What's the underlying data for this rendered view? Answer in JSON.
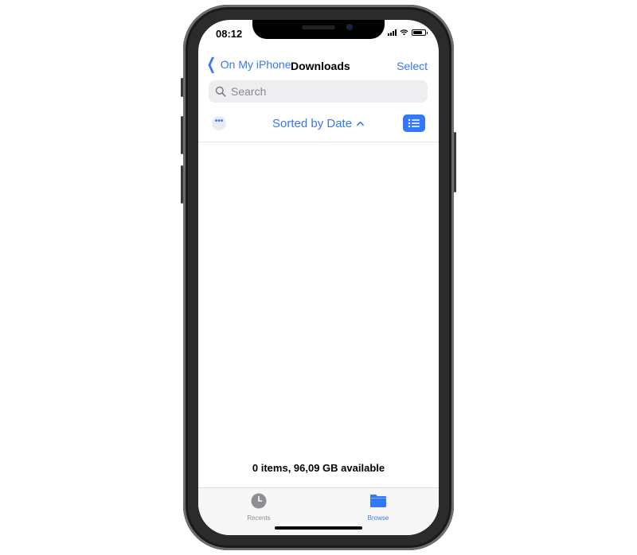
{
  "status_bar": {
    "time": "08:12"
  },
  "nav": {
    "back_label": "On My iPhone",
    "title": "Downloads",
    "select_label": "Select"
  },
  "search": {
    "placeholder": "Search"
  },
  "toolbar": {
    "more_glyph": "•••",
    "sort_label": "Sorted by Date"
  },
  "content": {
    "footer": "0 items, 96,09 GB available"
  },
  "tab_bar": {
    "tabs": [
      {
        "label": "Recents"
      },
      {
        "label": "Browse"
      }
    ],
    "active": "Browse"
  },
  "colors": {
    "accent": "#3478f6",
    "inactive": "#8e8e93"
  }
}
